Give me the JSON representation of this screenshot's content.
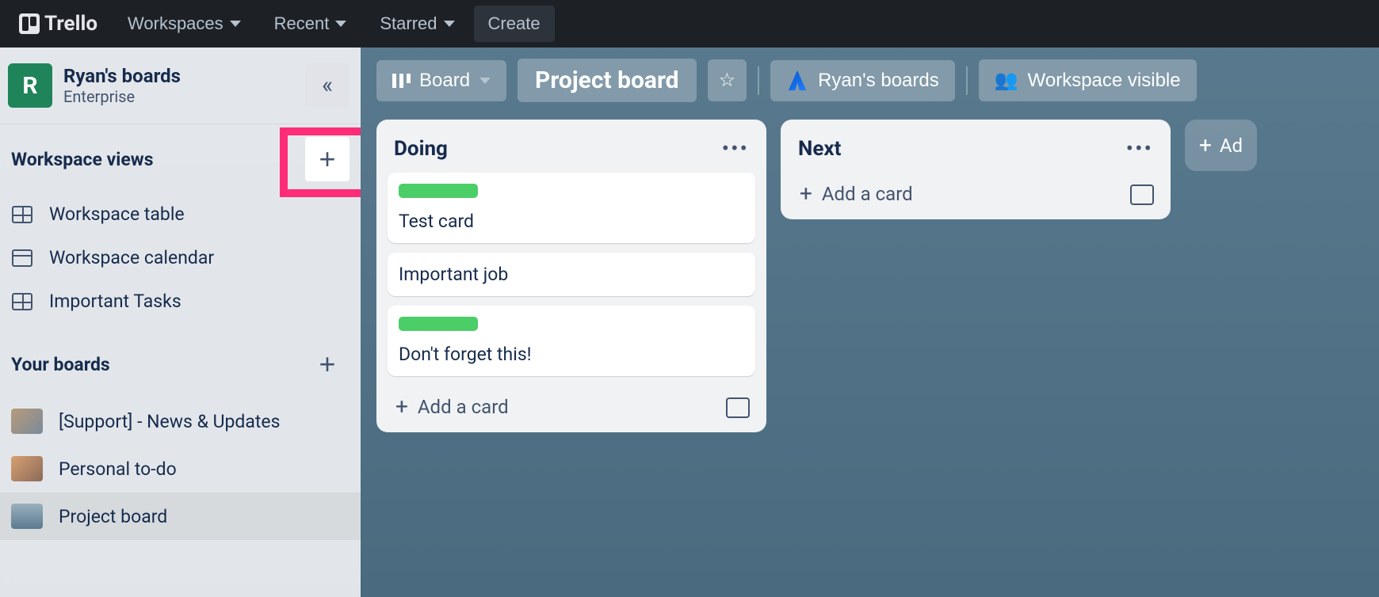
{
  "brand": "Trello",
  "topnav": {
    "workspaces": "Workspaces",
    "recent": "Recent",
    "starred": "Starred",
    "create": "Create"
  },
  "workspace": {
    "avatar_letter": "R",
    "name": "Ryan's boards",
    "tier": "Enterprise"
  },
  "sidebar": {
    "views_header": "Workspace views",
    "views": [
      {
        "label": "Workspace table"
      },
      {
        "label": "Workspace calendar"
      },
      {
        "label": "Important Tasks"
      }
    ],
    "your_boards_header": "Your boards",
    "boards": [
      {
        "label": "[Support] - News & Updates"
      },
      {
        "label": "Personal to-do"
      },
      {
        "label": "Project board"
      }
    ]
  },
  "boardbar": {
    "view_label": "Board",
    "title": "Project board",
    "workspace_label": "Ryan's boards",
    "visibility_label": "Workspace visible"
  },
  "lists": [
    {
      "title": "Doing",
      "cards": [
        {
          "has_green_label": true,
          "text": "Test card"
        },
        {
          "has_green_label": false,
          "text": "Important job"
        },
        {
          "has_green_label": true,
          "text": "Don't forget this!"
        }
      ],
      "add_card_label": "Add a card"
    },
    {
      "title": "Next",
      "cards": [],
      "add_card_label": "Add a card"
    }
  ],
  "add_list_label": "Ad"
}
